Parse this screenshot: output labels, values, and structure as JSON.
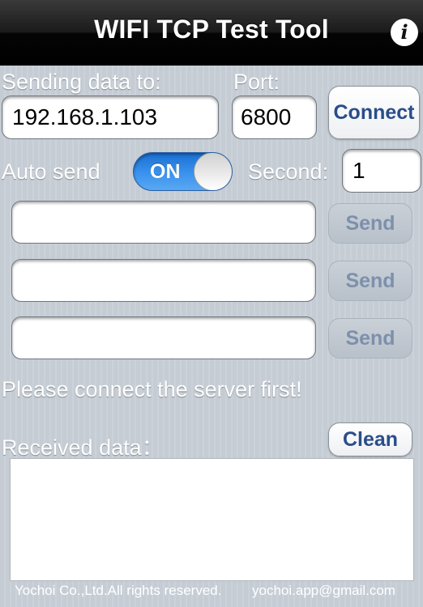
{
  "header": {
    "title": "WIFI TCP Test Tool",
    "info_label": "i"
  },
  "connection": {
    "sending_label": "Sending data to:",
    "ip_value": "192.168.1.103",
    "port_label": "Port:",
    "port_value": "6800",
    "connect_label": "Connect"
  },
  "auto_send": {
    "label": "Auto send",
    "toggle_state": "ON",
    "second_label": "Second:",
    "second_value": "1"
  },
  "send_rows": [
    {
      "value": "",
      "button": "Send"
    },
    {
      "value": "",
      "button": "Send"
    },
    {
      "value": "",
      "button": "Send"
    }
  ],
  "status": {
    "message": "Please connect the server first!"
  },
  "received": {
    "label": "Received data：",
    "clean_label": "Clean",
    "content": ""
  },
  "footer": {
    "copyright": "Yochoi Co.,Ltd.All rights reserved.",
    "email": "yochoi.app@gmail.com"
  },
  "colors": {
    "background": "#c5ccd4",
    "button_text": "#2a4d8a",
    "toggle_on": "#3a93ee"
  }
}
